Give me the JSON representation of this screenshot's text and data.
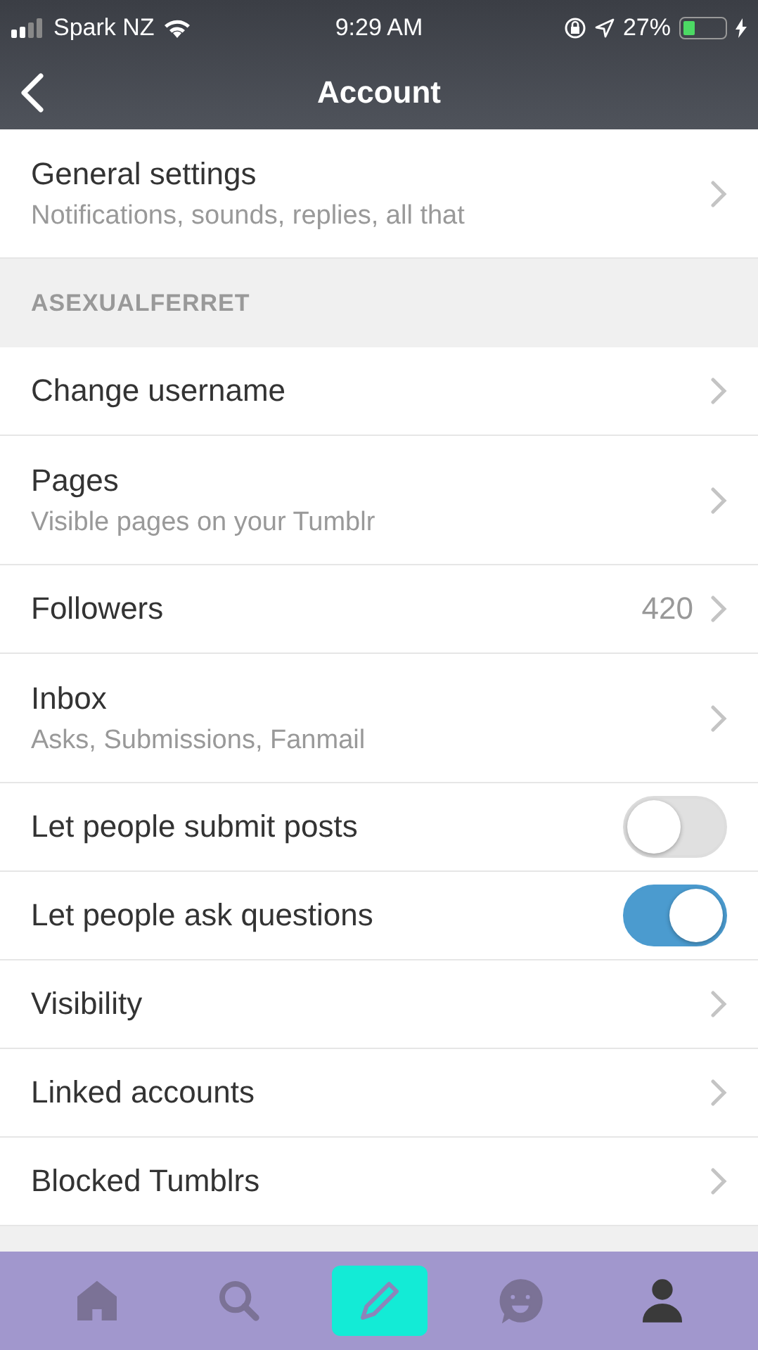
{
  "status_bar": {
    "carrier": "Spark NZ",
    "time": "9:29 AM",
    "battery": "27%"
  },
  "nav": {
    "title": "Account"
  },
  "general": {
    "title": "General settings",
    "subtitle": "Notifications, sounds, replies, all that"
  },
  "section": {
    "header": "ASEXUALFERRET",
    "rows": [
      {
        "kind": "link",
        "title": "Change username"
      },
      {
        "kind": "link",
        "title": "Pages",
        "subtitle": "Visible pages on your Tumblr"
      },
      {
        "kind": "link",
        "title": "Followers",
        "value": "420"
      },
      {
        "kind": "link",
        "title": "Inbox",
        "subtitle": "Asks, Submissions, Fanmail"
      },
      {
        "kind": "toggle",
        "title": "Let people submit posts",
        "on": false
      },
      {
        "kind": "toggle",
        "title": "Let people ask questions",
        "on": true
      },
      {
        "kind": "link",
        "title": "Visibility"
      },
      {
        "kind": "link",
        "title": "Linked accounts"
      },
      {
        "kind": "link",
        "title": "Blocked Tumblrs"
      }
    ]
  },
  "tab_bar": [
    {
      "kind": "home",
      "selected": false
    },
    {
      "kind": "search",
      "selected": false
    },
    {
      "kind": "compose",
      "selected": false
    },
    {
      "kind": "activity",
      "selected": false
    },
    {
      "kind": "account",
      "selected": true
    }
  ]
}
